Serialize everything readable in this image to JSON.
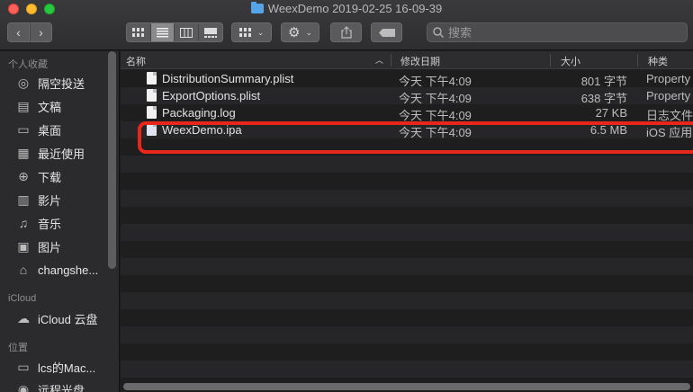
{
  "window": {
    "title": "WeexDemo 2019-02-25 16-09-39"
  },
  "toolbar": {
    "back_icon": "chevron-left",
    "forward_icon": "chevron-right",
    "view_modes": [
      "icon-view",
      "list-view",
      "column-view",
      "gallery-view"
    ],
    "active_view": "list-view",
    "search_placeholder": "搜索"
  },
  "sidebar": {
    "favorites_header": "个人收藏",
    "favorites": [
      {
        "label": "隔空投送",
        "icon": "airdrop-icon"
      },
      {
        "label": "文稿",
        "icon": "documents-icon"
      },
      {
        "label": "桌面",
        "icon": "desktop-icon"
      },
      {
        "label": "最近使用",
        "icon": "recents-icon"
      },
      {
        "label": "下载",
        "icon": "downloads-icon"
      },
      {
        "label": "影片",
        "icon": "movies-icon"
      },
      {
        "label": "音乐",
        "icon": "music-icon"
      },
      {
        "label": "图片",
        "icon": "pictures-icon"
      },
      {
        "label": "changshe...",
        "icon": "home-icon"
      }
    ],
    "icloud_header": "iCloud",
    "icloud": [
      {
        "label": "iCloud 云盘",
        "icon": "icloud-icon"
      }
    ],
    "locations_header": "位置",
    "locations": [
      {
        "label": "lcs的Mac...",
        "icon": "computer-icon"
      },
      {
        "label": "远程光盘",
        "icon": "remote-disc-icon"
      }
    ]
  },
  "list": {
    "columns": {
      "name": "名称",
      "date": "修改日期",
      "size": "大小",
      "kind": "种类"
    },
    "files": [
      {
        "name": "DistributionSummary.plist",
        "date": "今天 下午4:09",
        "size": "801 字节",
        "kind": "Property"
      },
      {
        "name": "ExportOptions.plist",
        "date": "今天 下午4:09",
        "size": "638 字节",
        "kind": "Property"
      },
      {
        "name": "Packaging.log",
        "date": "今天 下午4:09",
        "size": "27 KB",
        "kind": "日志文件"
      },
      {
        "name": "WeexDemo.ipa",
        "date": "今天 下午4:09",
        "size": "6.5 MB",
        "kind": "iOS 应用"
      }
    ]
  },
  "colors": {
    "highlight": "#e8261c"
  }
}
